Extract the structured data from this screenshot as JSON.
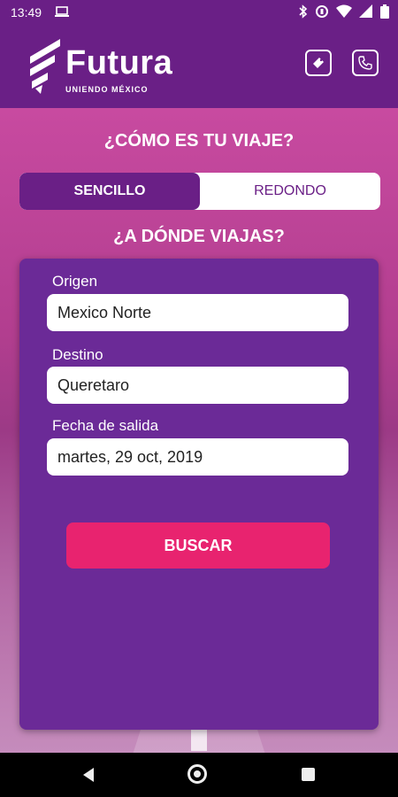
{
  "status_bar": {
    "time": "13:49",
    "icons": [
      "laptop-icon",
      "bluetooth-icon",
      "data-saver-icon",
      "wifi-icon",
      "signal-icon",
      "battery-icon"
    ]
  },
  "header": {
    "brand": "Futura",
    "tagline": "UNIENDO MÉXICO",
    "actions": [
      "ticket-icon",
      "phone-icon"
    ]
  },
  "trip": {
    "question": "¿CÓMO ES TU VIAJE?",
    "options": [
      {
        "label": "SENCILLO",
        "selected": true
      },
      {
        "label": "REDONDO",
        "selected": false
      }
    ]
  },
  "destination": {
    "question": "¿A DÓNDE VIAJAS?"
  },
  "form": {
    "origin_label": "Origen",
    "origin_value": "Mexico Norte",
    "dest_label": "Destino",
    "dest_value": "Queretaro",
    "date_label": "Fecha de salida",
    "date_value": "martes, 29 oct, 2019",
    "search_label": "BUSCAR"
  },
  "colors": {
    "primary": "#6a1f86",
    "accent": "#e8236f",
    "card": "#6b2a97"
  }
}
